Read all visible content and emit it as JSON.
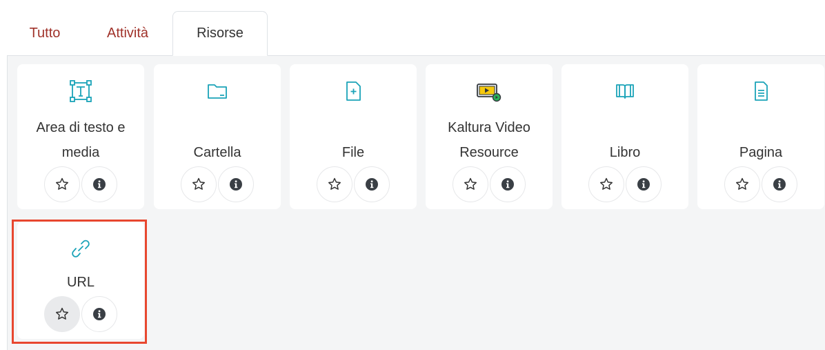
{
  "tabs": [
    {
      "label": "Tutto"
    },
    {
      "label": "Attività"
    },
    {
      "label": "Risorse",
      "active": true
    }
  ],
  "cards": [
    {
      "name": "area-di-testo-e-media",
      "label": "Area di testo e media",
      "icon": "text-area-icon"
    },
    {
      "name": "cartella",
      "label": "Cartella",
      "icon": "folder-icon"
    },
    {
      "name": "file",
      "label": "File",
      "icon": "file-icon"
    },
    {
      "name": "kaltura-video-resource",
      "label": "Kaltura Video Resource",
      "icon": "video-resource-icon"
    },
    {
      "name": "libro",
      "label": "Libro",
      "icon": "book-icon"
    },
    {
      "name": "pagina",
      "label": "Pagina",
      "icon": "page-icon"
    },
    {
      "name": "url",
      "label": "URL",
      "icon": "link-icon",
      "highlighted": true
    }
  ],
  "colors": {
    "accent_icon": "#1aa3b8",
    "tab_link": "#a0322a",
    "highlight_border": "#e8472f"
  }
}
